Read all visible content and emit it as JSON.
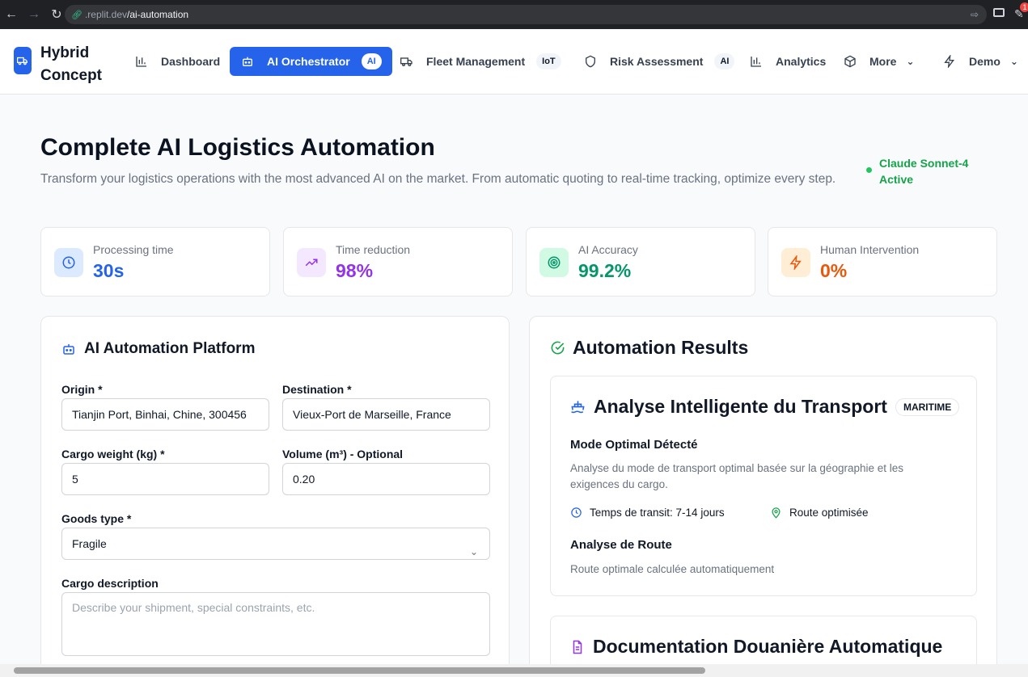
{
  "browser": {
    "url_domain": ".replit.dev",
    "url_path": "/ai-automation",
    "notification_count": "1"
  },
  "app": {
    "brand_line1": "Hybrid",
    "brand_line2": "Concept",
    "nav": [
      {
        "label": "Dashboard",
        "icon": "bar-chart-icon"
      },
      {
        "label": "AI Orchestrator",
        "pill": "AI",
        "icon": "bot-icon",
        "active": true
      },
      {
        "label": "Fleet Management",
        "pill": "IoT",
        "icon": "truck-icon"
      },
      {
        "label": "Risk Assessment",
        "pill": "AI",
        "icon": "shield-icon"
      },
      {
        "label": "Analytics",
        "icon": "bar-chart-icon"
      },
      {
        "label": "More",
        "icon": "box-icon"
      },
      {
        "label": "Demo",
        "icon": "zap-icon"
      }
    ]
  },
  "hero": {
    "title": "Complete AI Logistics Automation",
    "subtitle": "Transform your logistics operations with the most advanced AI on the market. From automatic quoting to real-time tracking, optimize every step.",
    "status_line1": "Claude Sonnet-4",
    "status_line2": "Active"
  },
  "stats": [
    {
      "label": "Processing time",
      "value": "30s",
      "color": "#2563eb",
      "bg": "#dbeafe",
      "icon": "clock-icon"
    },
    {
      "label": "Time reduction",
      "value": "98%",
      "color": "#9333ea",
      "bg": "#f3e8ff",
      "icon": "trending-up-icon"
    },
    {
      "label": "AI Accuracy",
      "value": "99.2%",
      "color": "#059669",
      "bg": "#d1fae5",
      "icon": "target-icon"
    },
    {
      "label": "Human Intervention",
      "value": "0%",
      "color": "#ea580c",
      "bg": "#ffedd5",
      "icon": "zap-icon"
    }
  ],
  "form": {
    "title": "AI Automation Platform",
    "origin_label": "Origin *",
    "origin_value": "Tianjin Port, Binhai, Chine, 300456",
    "destination_label": "Destination *",
    "destination_value": "Vieux-Port de Marseille, France",
    "weight_label": "Cargo weight (kg) *",
    "weight_value": "5",
    "volume_label": "Volume (m³) - Optional",
    "volume_value": "0.20",
    "goods_label": "Goods type *",
    "goods_value": "Fragile",
    "desc_label": "Cargo description",
    "desc_placeholder": "Describe your shipment, special constraints, etc."
  },
  "results": {
    "title": "Automation Results",
    "transport": {
      "title": "Analyse Intelligente du Transport",
      "tag": "MARITIME",
      "mode_heading": "Mode Optimal Détecté",
      "mode_text": "Analyse du mode de transport optimal basée sur la géographie et les exigences du cargo.",
      "transit": "Temps de transit: 7-14 jours",
      "route_opt": "Route optimisée",
      "route_heading": "Analyse de Route",
      "route_text": "Route optimale calculée automatiquement"
    },
    "customs": {
      "title": "Documentation Douanière Automatique"
    }
  }
}
